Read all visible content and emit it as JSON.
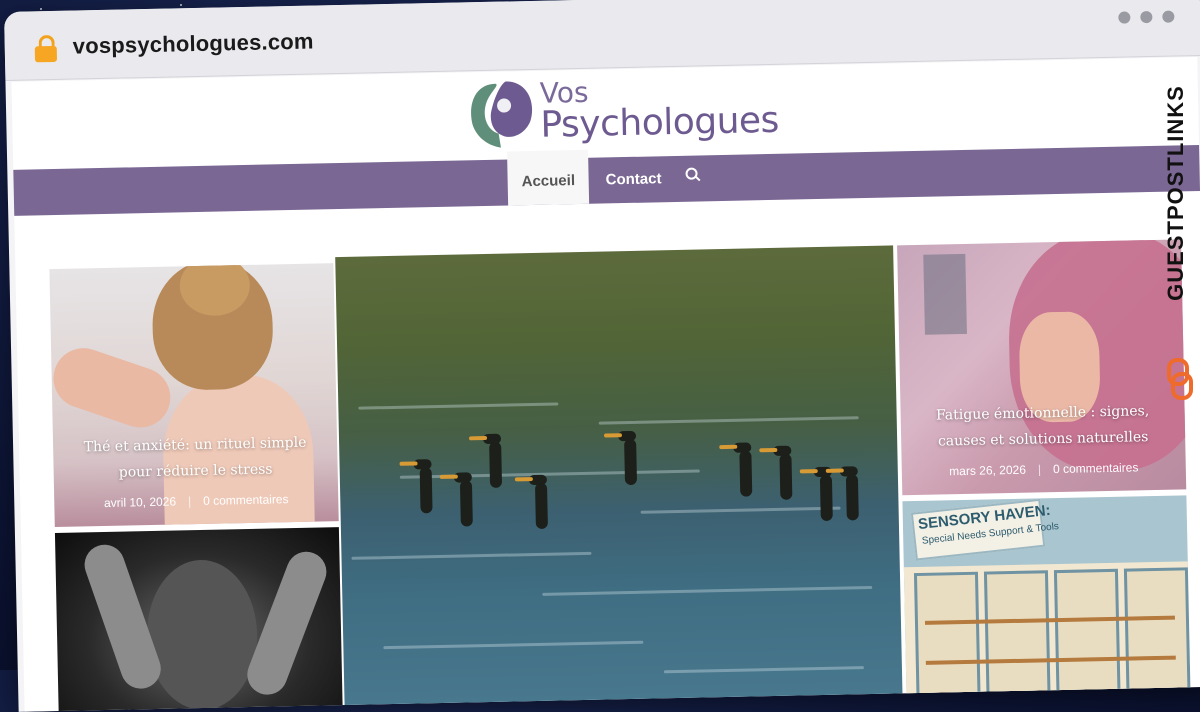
{
  "browser": {
    "url": "vospsychologues.com"
  },
  "site": {
    "logo_line1": "Vos",
    "logo_line2": "Psychologues"
  },
  "nav": {
    "items": [
      {
        "label": "Accueil",
        "active": true
      },
      {
        "label": "Contact",
        "active": false
      }
    ]
  },
  "posts": [
    {
      "title": "Thé et anxiété: un rituel simple pour réduire le stress",
      "date": "avril 10, 2026",
      "comments": "0 commentaires"
    },
    {
      "title": "Fatigue émotionnelle : signes, causes et solutions naturelles",
      "date": "mars 26, 2026",
      "comments": "0 commentaires"
    }
  ],
  "store_sign": {
    "title": "SENSORY HAVEN:",
    "subtitle": "Special Needs Support & Tools"
  },
  "watermark": {
    "text": "GUESTPOSTLINKS"
  },
  "colors": {
    "nav_bg": "#7a6793",
    "brand_purple": "#6c5a90",
    "brand_green": "#5f8f7a",
    "lock_orange": "#f6a623",
    "watermark_icon": "#ef6b2c"
  }
}
